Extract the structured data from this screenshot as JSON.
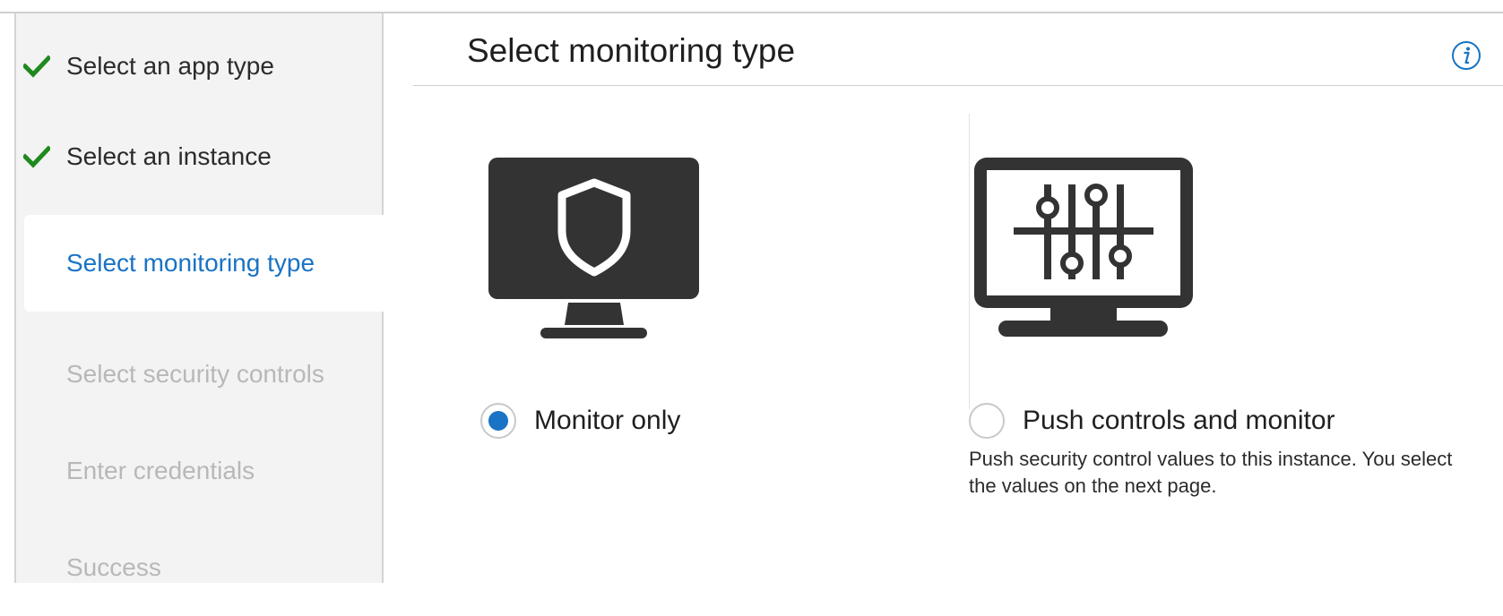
{
  "wizard": {
    "steps": [
      {
        "label": "Select an app type",
        "state": "done"
      },
      {
        "label": "Select an instance",
        "state": "done"
      },
      {
        "label": "Select monitoring type",
        "state": "current"
      },
      {
        "label": "Select security controls",
        "state": "pending"
      },
      {
        "label": "Enter credentials",
        "state": "pending"
      },
      {
        "label": "Success",
        "state": "pending"
      }
    ]
  },
  "main": {
    "title": "Select monitoring type",
    "info_icon": "info-icon",
    "options": [
      {
        "label": "Monitor only",
        "description": "",
        "selected": true,
        "icon": "monitor-shield-icon"
      },
      {
        "label": "Push controls and monitor",
        "description": "Push security control values to this instance. You select the values on the next page.",
        "selected": false,
        "icon": "monitor-sliders-icon"
      }
    ]
  },
  "colors": {
    "accent": "#1a73c4",
    "check": "#1e8a1e",
    "pending_text": "#b8b8b8",
    "icon_fill": "#333333"
  }
}
